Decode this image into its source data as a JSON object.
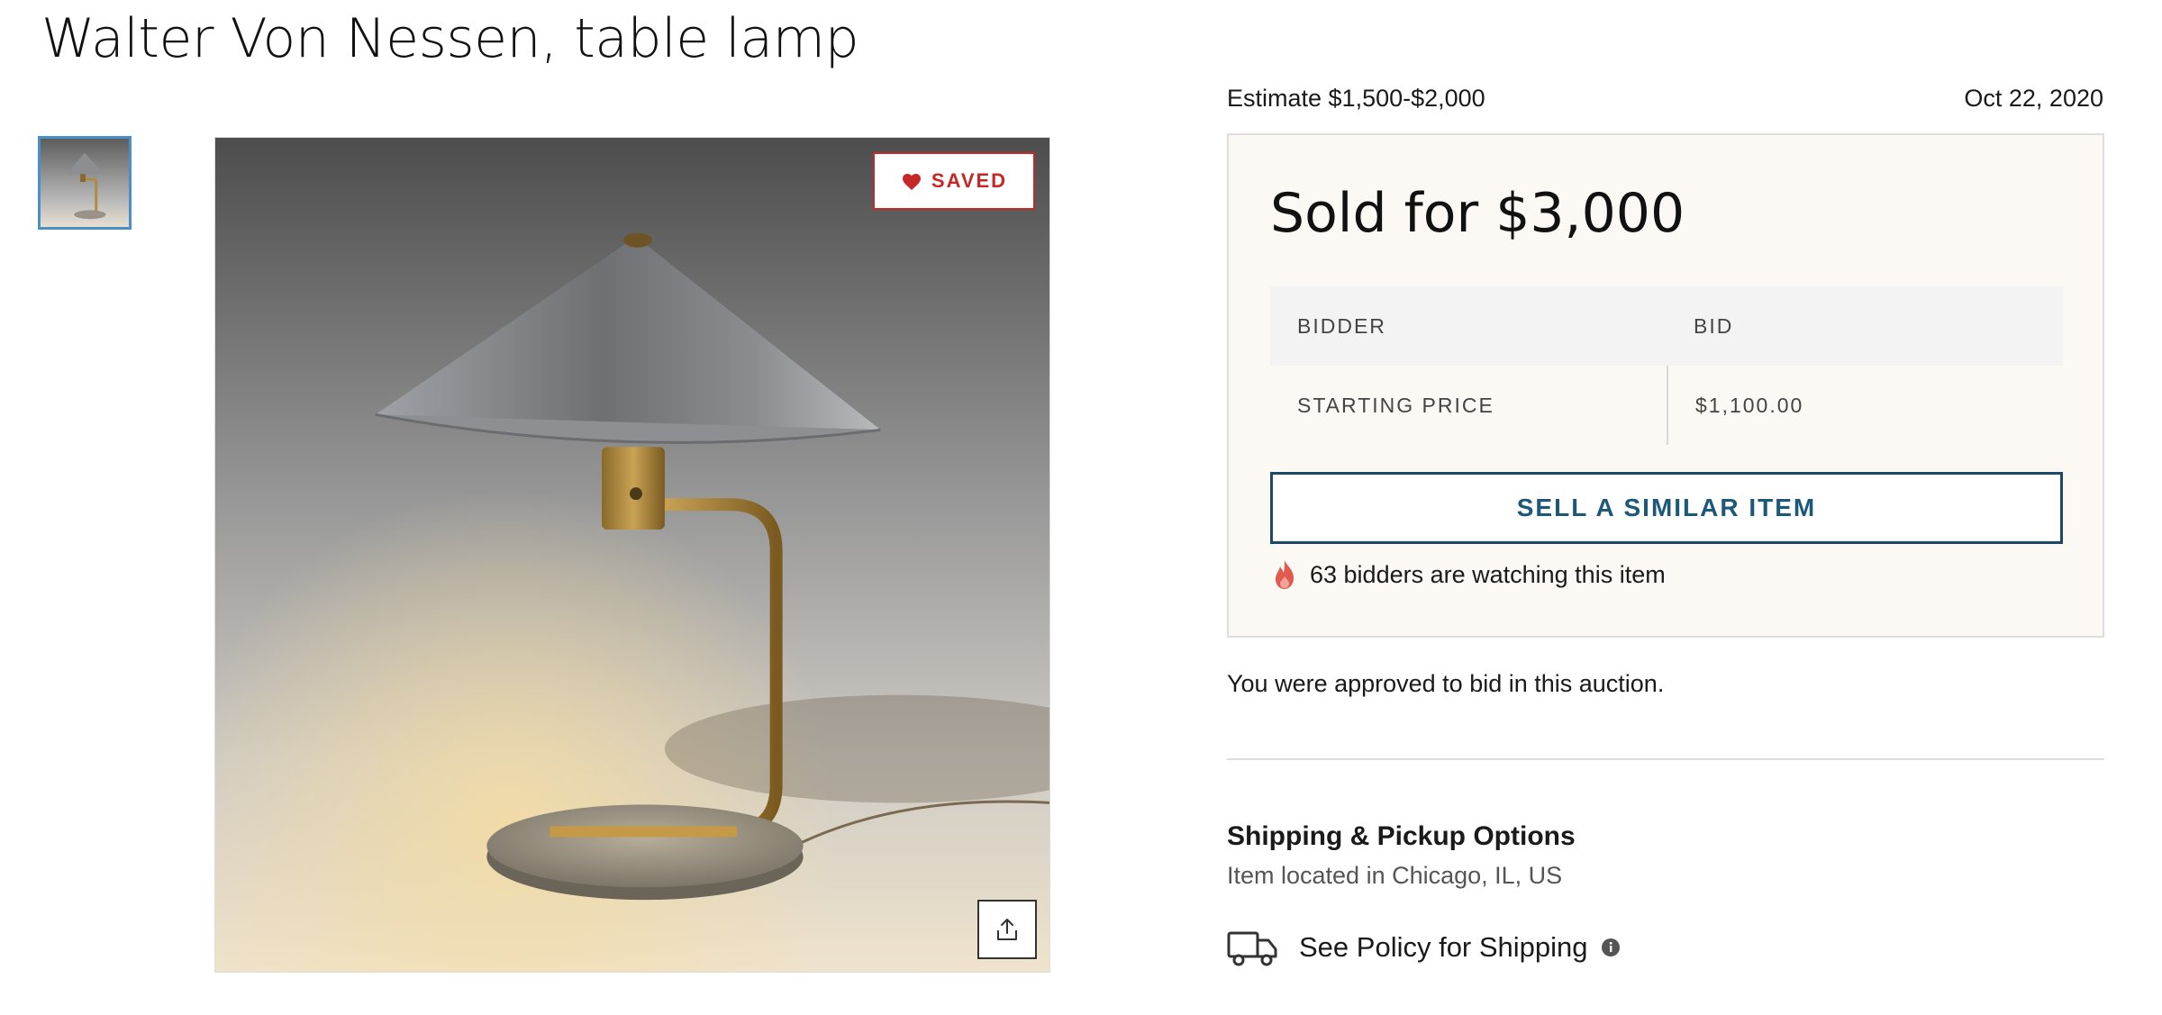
{
  "title": "Walter Von Nessen, table lamp",
  "gallery": {
    "thumbnail_icon": "lamp-thumbnail",
    "saved_label": "SAVED",
    "saved_icon": "heart-icon",
    "share_icon": "share-icon"
  },
  "auction": {
    "estimate": "Estimate $1,500-$2,000",
    "date": "Oct 22, 2020",
    "sold_label": "Sold for $3,000",
    "table": {
      "headers": [
        "BIDDER",
        "BID"
      ],
      "rows": [
        [
          "STARTING PRICE",
          "$1,100.00"
        ]
      ]
    },
    "sell_button": "SELL A SIMILAR ITEM",
    "watching_text": "63 bidders are watching this item",
    "watching_icon": "flame-icon"
  },
  "approved_text": "You were approved to bid in this auction.",
  "shipping": {
    "title": "Shipping & Pickup Options",
    "location": "Item located in Chicago, IL, US",
    "policy_label": "See Policy for Shipping",
    "truck_icon": "truck-icon",
    "info_icon": "info-icon"
  },
  "colors": {
    "accent": "#1c5878",
    "saved_red": "#c62828",
    "panel_bg": "#fcf8f3"
  }
}
